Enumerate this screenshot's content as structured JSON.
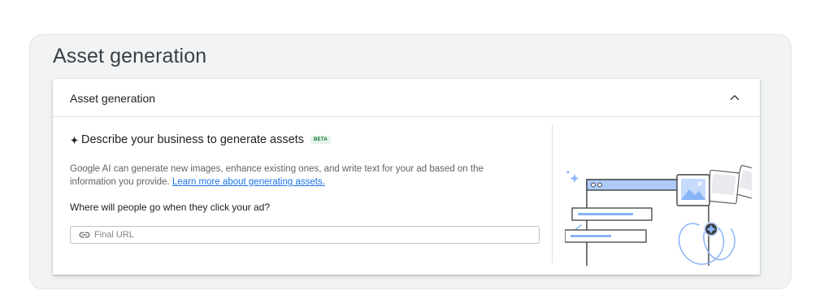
{
  "page": {
    "title": "Asset generation"
  },
  "card": {
    "header_title": "Asset generation",
    "heading": "Describe your business to generate assets",
    "beta_badge": "BETA",
    "description": "Google AI can generate new images, enhance existing ones, and write text for your ad based on the information you provide.",
    "learn_more_link": "Learn more about generating assets.",
    "question": "Where will people go when they click your ad?",
    "url_field": {
      "placeholder": "Final URL",
      "value": ""
    }
  },
  "icons": {
    "collapse": "chevron-up-icon",
    "sparkle": "sparkle-icon",
    "link": "link-icon",
    "illustration": "asset-generation-illustration"
  },
  "colors": {
    "accent": "#1a73e8",
    "beta_bg": "#e6f4ea",
    "beta_text": "#137333",
    "illustration_accent": "#8ab4f8",
    "illustration_dark": "#3c4043"
  }
}
